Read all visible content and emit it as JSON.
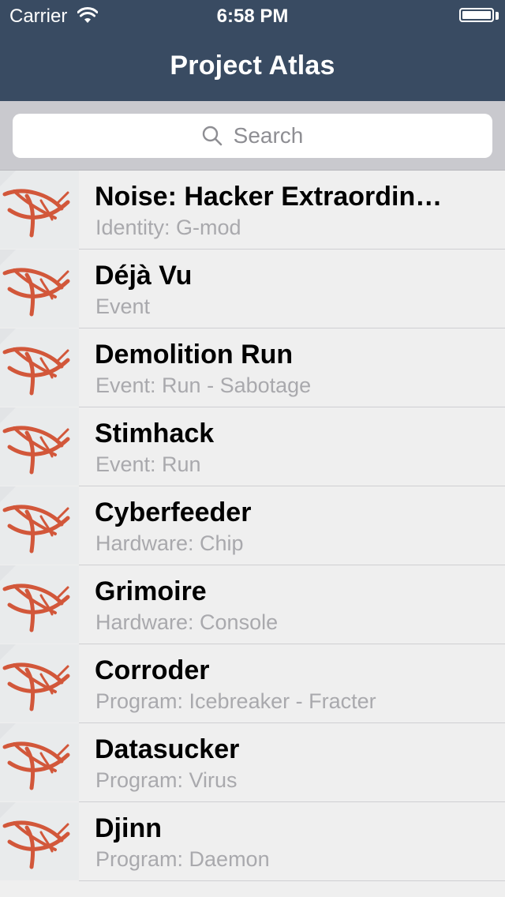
{
  "status_bar": {
    "carrier": "Carrier",
    "time": "6:58 PM"
  },
  "nav": {
    "title": "Project Atlas"
  },
  "search": {
    "placeholder": "Search"
  },
  "colors": {
    "nav_background": "#394b62",
    "logo_red": "#d2573a"
  },
  "icons": {
    "row_thumbnail": "anarch-logo-icon",
    "search": "search-icon",
    "wifi": "wifi-icon",
    "battery": "battery-icon"
  },
  "cards": [
    {
      "name": "Noise: Hacker Extraordin…",
      "type": "Identity: G-mod"
    },
    {
      "name": "Déjà Vu",
      "type": "Event"
    },
    {
      "name": "Demolition Run",
      "type": "Event: Run - Sabotage"
    },
    {
      "name": "Stimhack",
      "type": "Event: Run"
    },
    {
      "name": "Cyberfeeder",
      "type": "Hardware: Chip"
    },
    {
      "name": "Grimoire",
      "type": "Hardware: Console"
    },
    {
      "name": "Corroder",
      "type": "Program: Icebreaker - Fracter"
    },
    {
      "name": "Datasucker",
      "type": "Program: Virus"
    },
    {
      "name": "Djinn",
      "type": "Program: Daemon"
    }
  ]
}
